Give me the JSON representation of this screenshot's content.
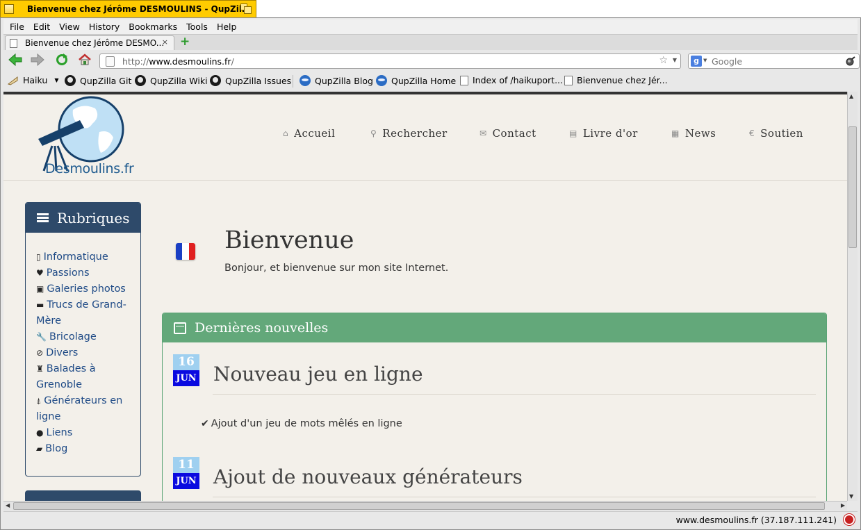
{
  "window": {
    "title": "Bienvenue chez Jérôme DESMOULINS - QupZilla"
  },
  "menu": [
    "File",
    "Edit",
    "View",
    "History",
    "Bookmarks",
    "Tools",
    "Help"
  ],
  "tab": {
    "label": "Bienvenue chez Jérôme DESMO...",
    "close": "×",
    "new": "+"
  },
  "urlbar": {
    "prefix": "http://",
    "host": "www.desmoulins.fr",
    "suffix": "/"
  },
  "search": {
    "engine": "g",
    "placeholder": "Google"
  },
  "bookmarks": {
    "folder": "Haiku",
    "items": [
      "QupZilla Git",
      "QupZilla Wiki",
      "QupZilla Issues",
      "QupZilla Blog",
      "QupZilla Home",
      "Index of /haikuport...",
      "Bienvenue chez Jér..."
    ]
  },
  "site": {
    "logo_text": "Desmoulins.fr",
    "nav": [
      {
        "label": "Accueil",
        "icon": "home-icon",
        "glyph": "⌂"
      },
      {
        "label": "Rechercher",
        "icon": "search-icon",
        "glyph": "⚲"
      },
      {
        "label": "Contact",
        "icon": "envelope-icon",
        "glyph": "✉"
      },
      {
        "label": "Livre d'or",
        "icon": "book-icon",
        "glyph": "▤"
      },
      {
        "label": "News",
        "icon": "calendar-icon",
        "glyph": "▦"
      },
      {
        "label": "Soutien",
        "icon": "euro-icon",
        "glyph": "€"
      }
    ]
  },
  "sidebar": {
    "title": "Rubriques",
    "items": [
      {
        "label": "Informatique",
        "icon": "mobile-icon",
        "glyph": "▯"
      },
      {
        "label": "Passions",
        "icon": "heart-icon",
        "glyph": "♥"
      },
      {
        "label": "Galeries photos",
        "icon": "picture-icon",
        "glyph": "▣"
      },
      {
        "label": "Trucs de Grand-Mère",
        "icon": "comment-icon",
        "glyph": "▬"
      },
      {
        "label": "Bricolage",
        "icon": "wrench-icon",
        "glyph": "🔧"
      },
      {
        "label": "Divers",
        "icon": "paperclip-icon",
        "glyph": "⊘"
      },
      {
        "label": "Balades à Grenoble",
        "icon": "chess-tower-icon",
        "glyph": "♜"
      },
      {
        "label": "Générateurs en ligne",
        "icon": "road-icon",
        "glyph": "⍋"
      },
      {
        "label": "Liens",
        "icon": "globe-icon",
        "glyph": "●"
      },
      {
        "label": "Blog",
        "icon": "briefcase-icon",
        "glyph": "▰"
      }
    ]
  },
  "welcome": {
    "title": "Bienvenue",
    "text": "Bonjour, et bienvenue sur mon site Internet."
  },
  "news": {
    "title": "Dernières nouvelles",
    "items": [
      {
        "day": "16",
        "month": "JUN",
        "title": "Nouveau jeu en ligne",
        "text": "Ajout d'un jeu de mots mêlés en ligne"
      },
      {
        "day": "11",
        "month": "JUN",
        "title": "Ajout de nouveaux générateurs"
      }
    ]
  },
  "status": {
    "text": "www.desmoulins.fr (37.187.111.241)"
  },
  "colors": {
    "accent_blue": "#2e4a6a",
    "news_green": "#63a87a",
    "title_yellow": "#ffcb00"
  }
}
